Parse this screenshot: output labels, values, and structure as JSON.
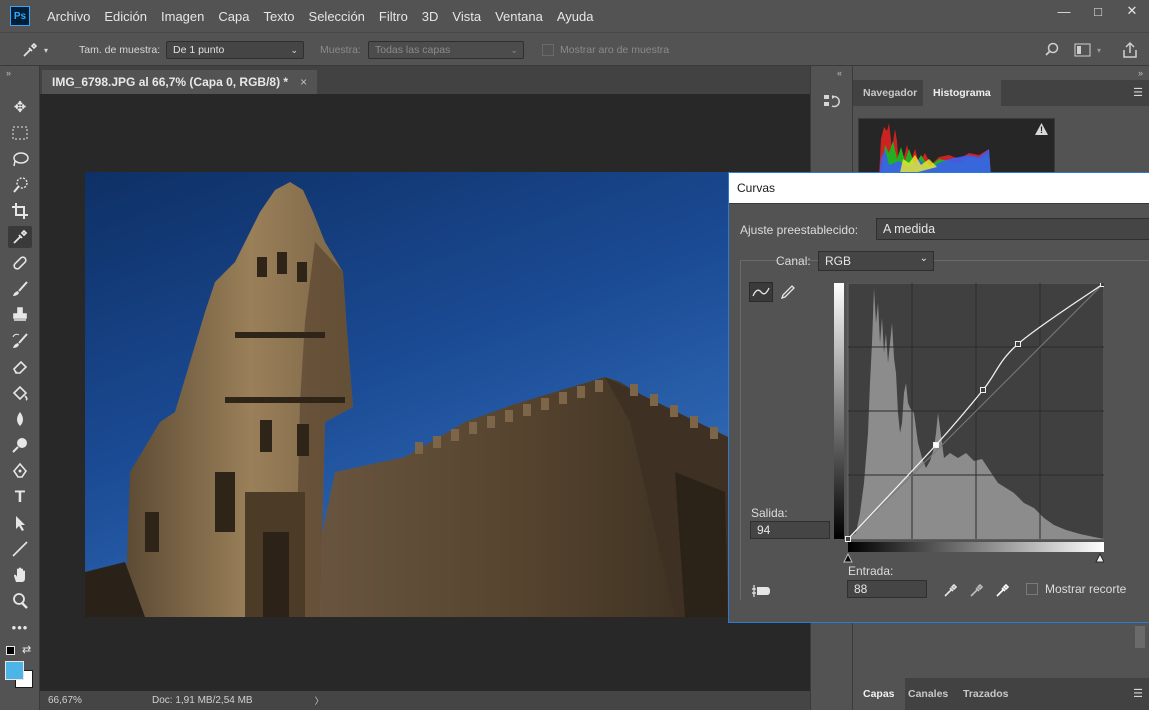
{
  "app": {
    "logo": "Ps"
  },
  "menu": [
    "Archivo",
    "Edición",
    "Imagen",
    "Capa",
    "Texto",
    "Selección",
    "Filtro",
    "3D",
    "Vista",
    "Ventana",
    "Ayuda"
  ],
  "window_controls": {
    "minimize": "—",
    "maximize": "□",
    "close": "✕"
  },
  "options": {
    "sample_size_label": "Tam. de muestra:",
    "sample_size_value": "De 1 punto",
    "sample_label": "Muestra:",
    "sample_value": "Todas las capas",
    "show_ring_label": "Mostrar aro de muestra"
  },
  "document": {
    "tab_title": "IMG_6798.JPG al 66,7% (Capa 0, RGB/8) *",
    "close_glyph": "×"
  },
  "status": {
    "zoom": "66,67%",
    "doc": "Doc: 1,91 MB/2,54 MB",
    "arrow": "〉"
  },
  "panels": {
    "top_tabs": [
      "Navegador",
      "Histograma"
    ],
    "active_top_tab": "Histograma",
    "bottom_tabs": [
      "Capas",
      "Canales",
      "Trazados"
    ],
    "active_bottom_tab": "Capas",
    "warning": "!"
  },
  "curves": {
    "title": "Curvas",
    "preset_label": "Ajuste preestablecido:",
    "preset_value": "A medida",
    "channel_label": "Canal:",
    "channel_value": "RGB",
    "output_label": "Salida:",
    "output_value": "94",
    "input_label": "Entrada:",
    "input_value": "88",
    "show_clipping_label": "Mostrar recorte",
    "curve_points": [
      [
        0,
        0
      ],
      [
        88,
        94
      ],
      [
        135,
        149
      ],
      [
        170,
        195
      ],
      [
        255,
        255
      ]
    ]
  },
  "colors": {
    "foreground": "#4cb4e6",
    "background": "#ffffff",
    "accent_border": "#2c7ad6"
  },
  "tool_icons": [
    "move-icon",
    "marquee-icon",
    "lasso-icon",
    "quick-select-icon",
    "crop-icon",
    "eyedropper-icon",
    "healing-icon",
    "brush-icon",
    "stamp-icon",
    "history-brush-icon",
    "eraser-icon",
    "gradient-icon",
    "blur-icon",
    "dodge-icon",
    "pen-icon",
    "type-icon",
    "path-select-icon",
    "line-icon",
    "hand-icon",
    "zoom-icon",
    "more-icon"
  ]
}
